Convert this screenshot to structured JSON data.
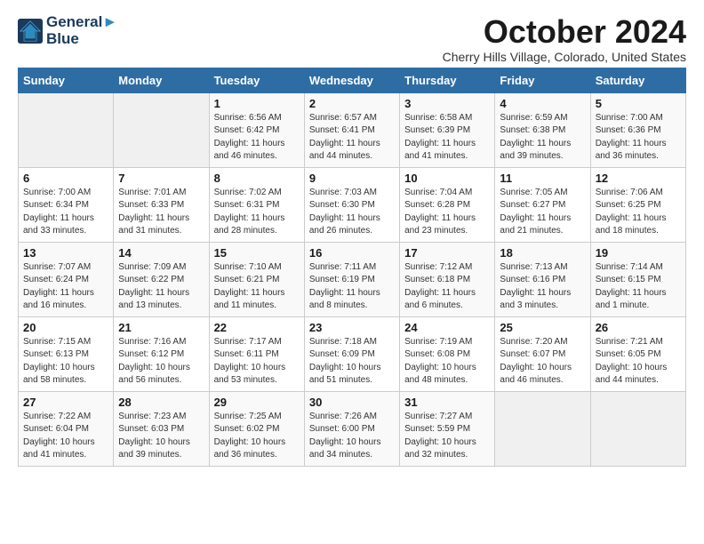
{
  "header": {
    "logo_line1": "General",
    "logo_line2": "Blue",
    "month_title": "October 2024",
    "subtitle": "Cherry Hills Village, Colorado, United States"
  },
  "days_of_week": [
    "Sunday",
    "Monday",
    "Tuesday",
    "Wednesday",
    "Thursday",
    "Friday",
    "Saturday"
  ],
  "weeks": [
    [
      {
        "day": "",
        "empty": true
      },
      {
        "day": "",
        "empty": true
      },
      {
        "day": "1",
        "sunrise": "Sunrise: 6:56 AM",
        "sunset": "Sunset: 6:42 PM",
        "daylight": "Daylight: 11 hours and 46 minutes."
      },
      {
        "day": "2",
        "sunrise": "Sunrise: 6:57 AM",
        "sunset": "Sunset: 6:41 PM",
        "daylight": "Daylight: 11 hours and 44 minutes."
      },
      {
        "day": "3",
        "sunrise": "Sunrise: 6:58 AM",
        "sunset": "Sunset: 6:39 PM",
        "daylight": "Daylight: 11 hours and 41 minutes."
      },
      {
        "day": "4",
        "sunrise": "Sunrise: 6:59 AM",
        "sunset": "Sunset: 6:38 PM",
        "daylight": "Daylight: 11 hours and 39 minutes."
      },
      {
        "day": "5",
        "sunrise": "Sunrise: 7:00 AM",
        "sunset": "Sunset: 6:36 PM",
        "daylight": "Daylight: 11 hours and 36 minutes."
      }
    ],
    [
      {
        "day": "6",
        "sunrise": "Sunrise: 7:00 AM",
        "sunset": "Sunset: 6:34 PM",
        "daylight": "Daylight: 11 hours and 33 minutes."
      },
      {
        "day": "7",
        "sunrise": "Sunrise: 7:01 AM",
        "sunset": "Sunset: 6:33 PM",
        "daylight": "Daylight: 11 hours and 31 minutes."
      },
      {
        "day": "8",
        "sunrise": "Sunrise: 7:02 AM",
        "sunset": "Sunset: 6:31 PM",
        "daylight": "Daylight: 11 hours and 28 minutes."
      },
      {
        "day": "9",
        "sunrise": "Sunrise: 7:03 AM",
        "sunset": "Sunset: 6:30 PM",
        "daylight": "Daylight: 11 hours and 26 minutes."
      },
      {
        "day": "10",
        "sunrise": "Sunrise: 7:04 AM",
        "sunset": "Sunset: 6:28 PM",
        "daylight": "Daylight: 11 hours and 23 minutes."
      },
      {
        "day": "11",
        "sunrise": "Sunrise: 7:05 AM",
        "sunset": "Sunset: 6:27 PM",
        "daylight": "Daylight: 11 hours and 21 minutes."
      },
      {
        "day": "12",
        "sunrise": "Sunrise: 7:06 AM",
        "sunset": "Sunset: 6:25 PM",
        "daylight": "Daylight: 11 hours and 18 minutes."
      }
    ],
    [
      {
        "day": "13",
        "sunrise": "Sunrise: 7:07 AM",
        "sunset": "Sunset: 6:24 PM",
        "daylight": "Daylight: 11 hours and 16 minutes."
      },
      {
        "day": "14",
        "sunrise": "Sunrise: 7:09 AM",
        "sunset": "Sunset: 6:22 PM",
        "daylight": "Daylight: 11 hours and 13 minutes."
      },
      {
        "day": "15",
        "sunrise": "Sunrise: 7:10 AM",
        "sunset": "Sunset: 6:21 PM",
        "daylight": "Daylight: 11 hours and 11 minutes."
      },
      {
        "day": "16",
        "sunrise": "Sunrise: 7:11 AM",
        "sunset": "Sunset: 6:19 PM",
        "daylight": "Daylight: 11 hours and 8 minutes."
      },
      {
        "day": "17",
        "sunrise": "Sunrise: 7:12 AM",
        "sunset": "Sunset: 6:18 PM",
        "daylight": "Daylight: 11 hours and 6 minutes."
      },
      {
        "day": "18",
        "sunrise": "Sunrise: 7:13 AM",
        "sunset": "Sunset: 6:16 PM",
        "daylight": "Daylight: 11 hours and 3 minutes."
      },
      {
        "day": "19",
        "sunrise": "Sunrise: 7:14 AM",
        "sunset": "Sunset: 6:15 PM",
        "daylight": "Daylight: 11 hours and 1 minute."
      }
    ],
    [
      {
        "day": "20",
        "sunrise": "Sunrise: 7:15 AM",
        "sunset": "Sunset: 6:13 PM",
        "daylight": "Daylight: 10 hours and 58 minutes."
      },
      {
        "day": "21",
        "sunrise": "Sunrise: 7:16 AM",
        "sunset": "Sunset: 6:12 PM",
        "daylight": "Daylight: 10 hours and 56 minutes."
      },
      {
        "day": "22",
        "sunrise": "Sunrise: 7:17 AM",
        "sunset": "Sunset: 6:11 PM",
        "daylight": "Daylight: 10 hours and 53 minutes."
      },
      {
        "day": "23",
        "sunrise": "Sunrise: 7:18 AM",
        "sunset": "Sunset: 6:09 PM",
        "daylight": "Daylight: 10 hours and 51 minutes."
      },
      {
        "day": "24",
        "sunrise": "Sunrise: 7:19 AM",
        "sunset": "Sunset: 6:08 PM",
        "daylight": "Daylight: 10 hours and 48 minutes."
      },
      {
        "day": "25",
        "sunrise": "Sunrise: 7:20 AM",
        "sunset": "Sunset: 6:07 PM",
        "daylight": "Daylight: 10 hours and 46 minutes."
      },
      {
        "day": "26",
        "sunrise": "Sunrise: 7:21 AM",
        "sunset": "Sunset: 6:05 PM",
        "daylight": "Daylight: 10 hours and 44 minutes."
      }
    ],
    [
      {
        "day": "27",
        "sunrise": "Sunrise: 7:22 AM",
        "sunset": "Sunset: 6:04 PM",
        "daylight": "Daylight: 10 hours and 41 minutes."
      },
      {
        "day": "28",
        "sunrise": "Sunrise: 7:23 AM",
        "sunset": "Sunset: 6:03 PM",
        "daylight": "Daylight: 10 hours and 39 minutes."
      },
      {
        "day": "29",
        "sunrise": "Sunrise: 7:25 AM",
        "sunset": "Sunset: 6:02 PM",
        "daylight": "Daylight: 10 hours and 36 minutes."
      },
      {
        "day": "30",
        "sunrise": "Sunrise: 7:26 AM",
        "sunset": "Sunset: 6:00 PM",
        "daylight": "Daylight: 10 hours and 34 minutes."
      },
      {
        "day": "31",
        "sunrise": "Sunrise: 7:27 AM",
        "sunset": "Sunset: 5:59 PM",
        "daylight": "Daylight: 10 hours and 32 minutes."
      },
      {
        "day": "",
        "empty": true
      },
      {
        "day": "",
        "empty": true
      }
    ]
  ]
}
